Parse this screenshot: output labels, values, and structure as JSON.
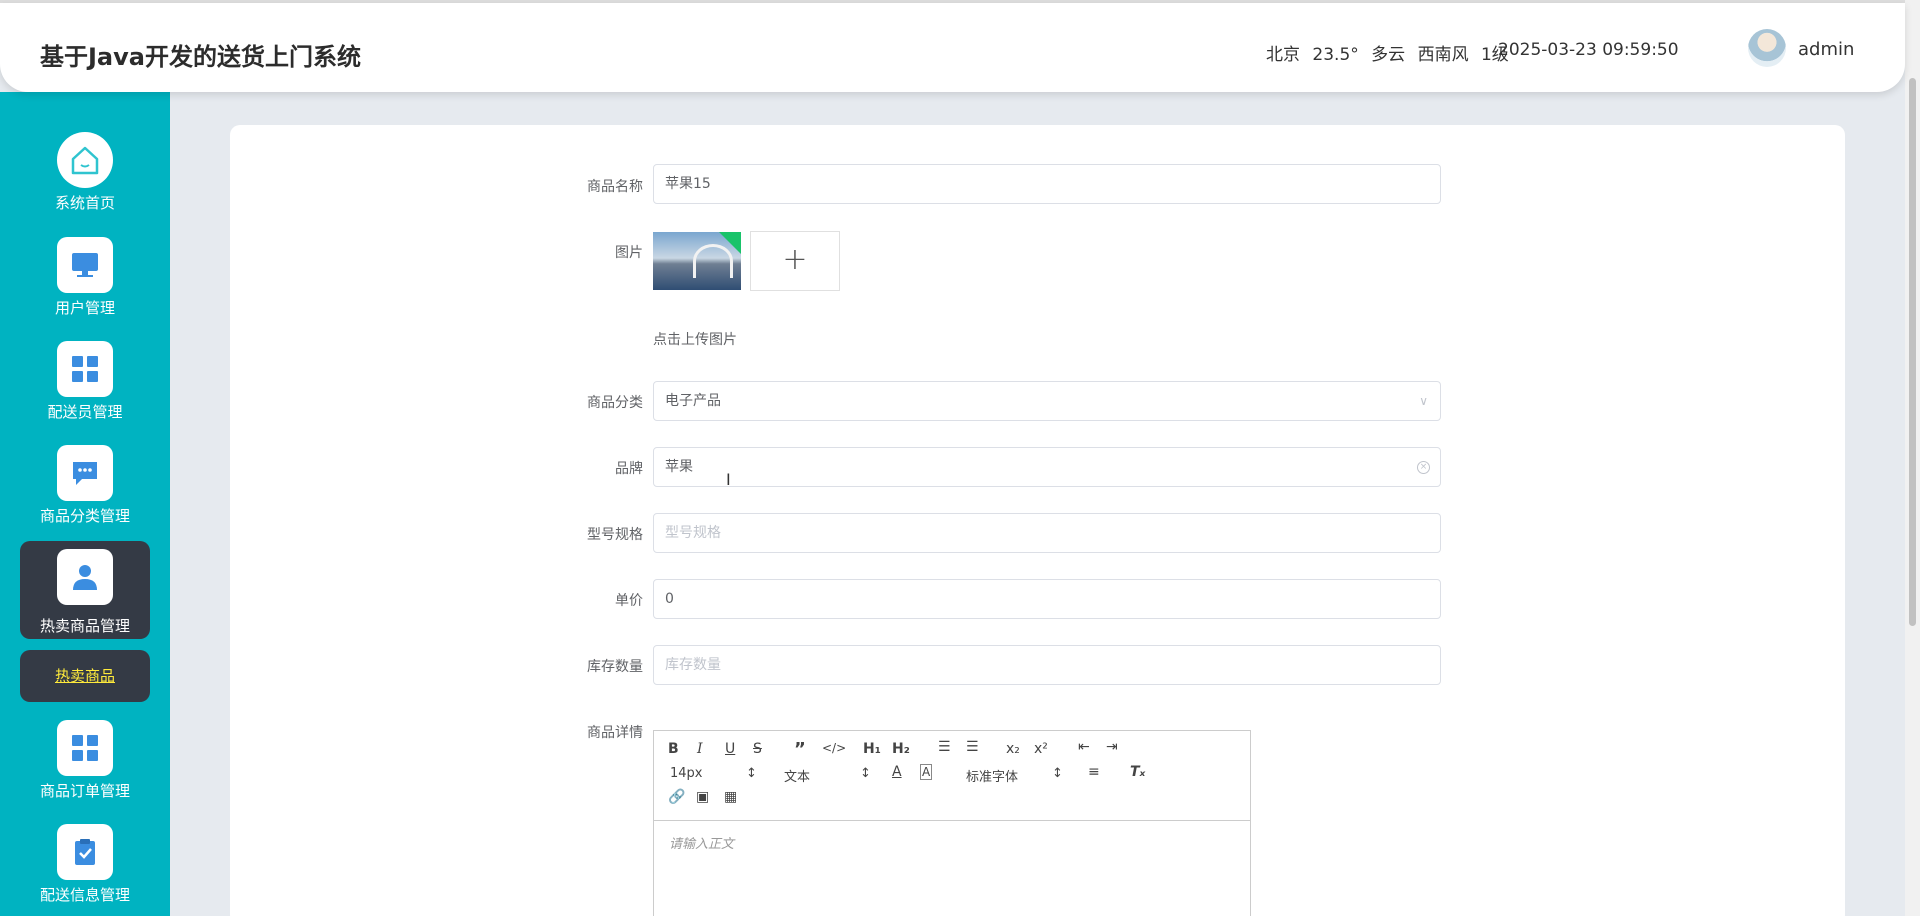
{
  "header": {
    "title": "基于Java开发的送货上门系统",
    "weather": {
      "city": "北京",
      "temp": "23.5°",
      "condition": "多云",
      "wind": "西南风",
      "wind_level": "1级"
    },
    "datetime": "2025-03-23 09:59:50",
    "user": "admin"
  },
  "sidebar": {
    "items": [
      {
        "label": "系统首页",
        "icon": "home-icon"
      },
      {
        "label": "用户管理",
        "icon": "monitor-icon"
      },
      {
        "label": "配送员管理",
        "icon": "grid-icon"
      },
      {
        "label": "商品分类管理",
        "icon": "chat-icon"
      },
      {
        "label": "热卖商品管理",
        "icon": "user-icon"
      },
      {
        "label": "商品订单管理",
        "icon": "grid-icon"
      },
      {
        "label": "配送信息管理",
        "icon": "clipboard-icon"
      }
    ],
    "sub_item": "热卖商品"
  },
  "form": {
    "name_label": "商品名称",
    "name_value": "苹果15",
    "image_label": "图片",
    "upload_hint": "点击上传图片",
    "category_label": "商品分类",
    "category_value": "电子产品",
    "brand_label": "品牌",
    "brand_value": "苹果",
    "model_label": "型号规格",
    "model_placeholder": "型号规格",
    "price_label": "单价",
    "price_value": "0",
    "stock_label": "库存数量",
    "stock_placeholder": "库存数量",
    "detail_label": "商品详情"
  },
  "editor": {
    "font_size": "14px",
    "text_type": "文本",
    "font_family": "标准字体",
    "placeholder": "请输入正文"
  }
}
